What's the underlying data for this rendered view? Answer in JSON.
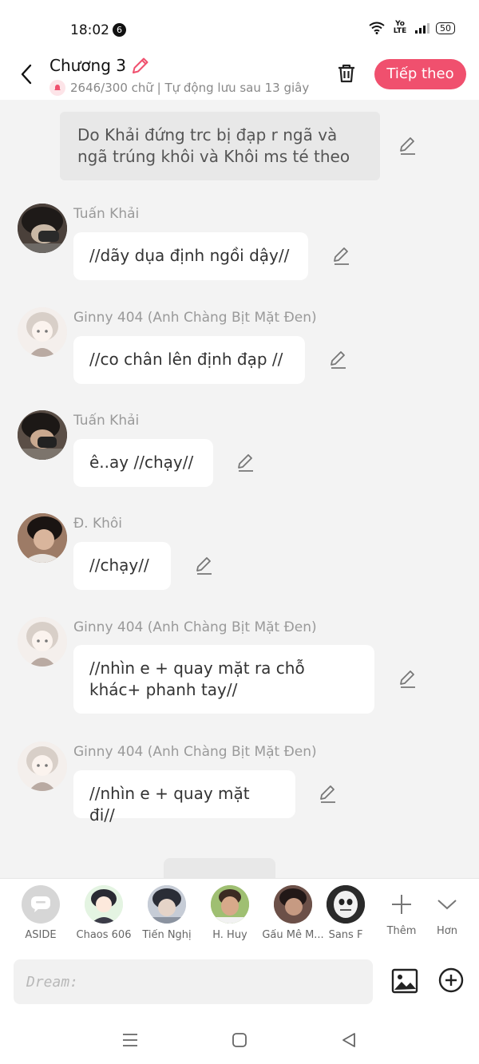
{
  "status": {
    "time": "18:02",
    "badge": "6",
    "battery": "50",
    "network": "Yo LTE"
  },
  "header": {
    "title": "Chương 3",
    "subtitle": "2646/300 chữ | Tự động lưu sau 13 giây",
    "next_label": "Tiếp theo"
  },
  "narration": "Do Khải đứng trc bị đạp r ngã và ngã trúng khôi và Khôi ms té theo",
  "messages": [
    {
      "author": "Tuấn Khải",
      "text": "//dãy dụa định ngồi dậy//"
    },
    {
      "author": "Ginny 404 (Anh Chàng Bịt Mặt Đen)",
      "text": "//co chân lên định đạp //"
    },
    {
      "author": "Tuấn Khải",
      "text": "ê..ay //chạy//"
    },
    {
      "author": "Đ. Khôi",
      "text": "//chạy//"
    },
    {
      "author": "Ginny 404 (Anh Chàng Bịt Mặt Đen)",
      "text": "//nhìn e + quay mặt ra chỗ khác+ phanh tay//"
    },
    {
      "author": "Ginny 404 (Anh Chàng Bịt Mặt Đen)",
      "text": "//nhìn e + quay mặt đi//"
    }
  ],
  "characters": [
    {
      "name": "ASIDE"
    },
    {
      "name": "Chaos 606"
    },
    {
      "name": "Tiến Nghị"
    },
    {
      "name": "H. Huy"
    },
    {
      "name": "Gấu Mê M..."
    },
    {
      "name": "Sans F"
    }
  ],
  "bar_actions": {
    "more": "Thêm",
    "expand": "Hơn"
  },
  "input": {
    "placeholder": "Dream:"
  },
  "colors": {
    "accent": "#f0506e",
    "bubble": "#ffffff",
    "narration_bg": "#e8e8e8",
    "background": "#f3f3f3"
  }
}
